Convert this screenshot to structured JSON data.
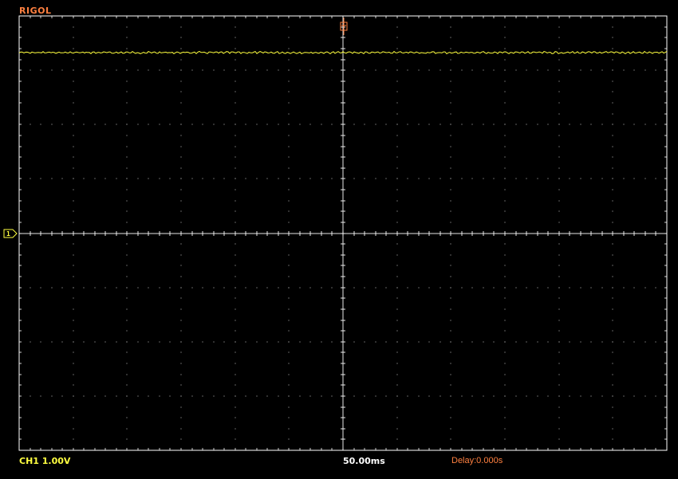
{
  "header": {
    "brand": "RIGOL"
  },
  "status": {
    "channel_readout": "CH1 1.00V",
    "timebase_readout": "50.00ms",
    "delay_readout": "Delay:0.000s"
  },
  "markers": {
    "channel_marker_label": "1",
    "trigger_marker_label": "T"
  },
  "colors": {
    "background": "#000000",
    "grid": "#ffffff",
    "trace": "#ffff40",
    "accent": "#ff8040"
  },
  "icons": {
    "channel_marker": "ch1-ground-marker-icon",
    "trigger_marker": "trigger-position-icon"
  }
}
